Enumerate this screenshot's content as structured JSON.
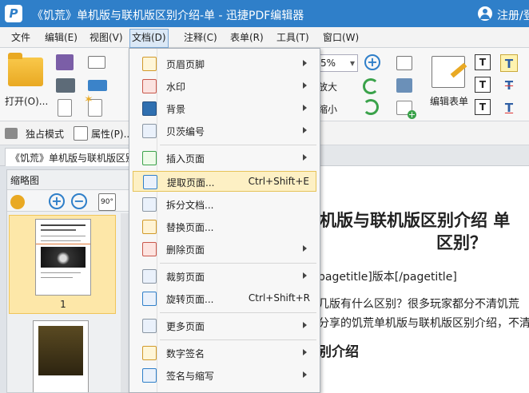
{
  "window": {
    "title": "《饥荒》单机版与联机版区别介绍-单  -  迅捷PDF编辑器",
    "login_label": "注册/登"
  },
  "menubar": {
    "items": [
      {
        "label": "文件"
      },
      {
        "label": "编辑(E)"
      },
      {
        "label": "视图(V)"
      },
      {
        "label": "文档(D)"
      },
      {
        "label": "注释(C)"
      },
      {
        "label": "表单(R)"
      },
      {
        "label": "工具(T)"
      },
      {
        "label": "窗口(W)"
      }
    ]
  },
  "ribbon": {
    "open_label": "打开(O)...",
    "zoom_value": "5%",
    "zoom_in_label": "放大",
    "zoom_out_label": "缩小",
    "edit_form_label": "编辑表单",
    "textbox_glyph": "T",
    "textfmt_glyph": "T"
  },
  "toolbar2": {
    "solo_label": "独占模式",
    "props_label": "属性(P)..."
  },
  "tab": {
    "doc_tab_label": "《饥荒》单机版与联机版区别"
  },
  "thumbnails": {
    "title": "缩略图",
    "rotate_label": "90°",
    "page_number": "1"
  },
  "document": {
    "title_line1": "机版与联机版区别介绍 单",
    "title_line2": "区别？",
    "pagetitle": "pagetitle]版本[/pagetitle]",
    "para1": "几版有什么区别？很多玩家都分不清饥荒",
    "para2": "分享的饥荒单机版与联机版区别介绍，不清",
    "subheading": "别介绍"
  },
  "doc_menu": {
    "items": [
      {
        "label": "页眉页脚",
        "shortcut": "",
        "submenu": true
      },
      {
        "label": "水印",
        "shortcut": "",
        "submenu": true
      },
      {
        "label": "背景",
        "shortcut": "",
        "submenu": true
      },
      {
        "label": "贝茨编号",
        "shortcut": "",
        "submenu": true
      },
      {
        "label": "插入页面",
        "shortcut": "",
        "submenu": true
      },
      {
        "label": "提取页面...",
        "shortcut": "Ctrl+Shift+E",
        "submenu": false,
        "highlighted": true
      },
      {
        "label": "拆分文档...",
        "shortcut": "",
        "submenu": false
      },
      {
        "label": "替换页面...",
        "shortcut": "",
        "submenu": false
      },
      {
        "label": "删除页面",
        "shortcut": "",
        "submenu": true
      },
      {
        "label": "裁剪页面",
        "shortcut": "",
        "submenu": true
      },
      {
        "label": "旋转页面...",
        "shortcut": "Ctrl+Shift+R",
        "submenu": false
      },
      {
        "label": "更多页面",
        "shortcut": "",
        "submenu": true
      },
      {
        "label": "数字签名",
        "shortcut": "",
        "submenu": true
      },
      {
        "label": "签名与缩写",
        "shortcut": "",
        "submenu": true
      }
    ]
  },
  "colors": {
    "title_bar": "#2f7fc9",
    "menu_highlight": "#fdf0c4",
    "thumbnail_selected": "#fde7a8"
  }
}
